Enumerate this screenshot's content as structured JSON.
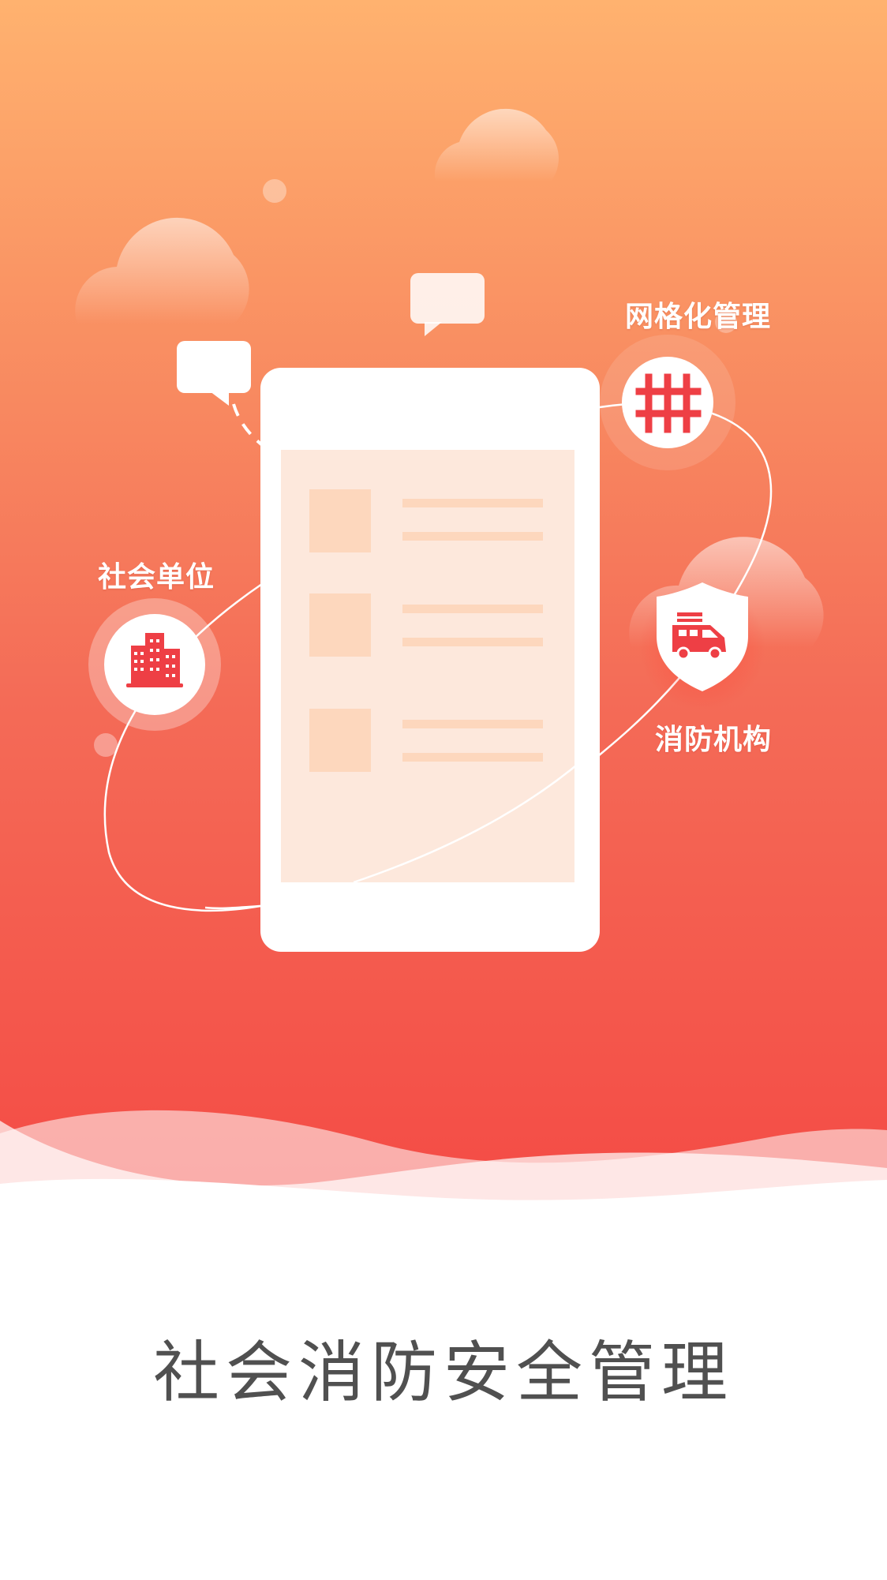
{
  "screen": {
    "title": "社会消防安全管理"
  },
  "nodes": {
    "grid_management": {
      "label": "网格化管理",
      "icon": "grid-hash-icon"
    },
    "social_unit": {
      "label": "社会单位",
      "icon": "building-icon"
    },
    "fire_agency": {
      "label": "消防机构",
      "icon": "fire-truck-shield-icon"
    }
  },
  "colors": {
    "gradient_top": "#ffb26f",
    "gradient_bottom": "#f44b45",
    "accent": "#f0484a",
    "title_text": "#505050"
  }
}
